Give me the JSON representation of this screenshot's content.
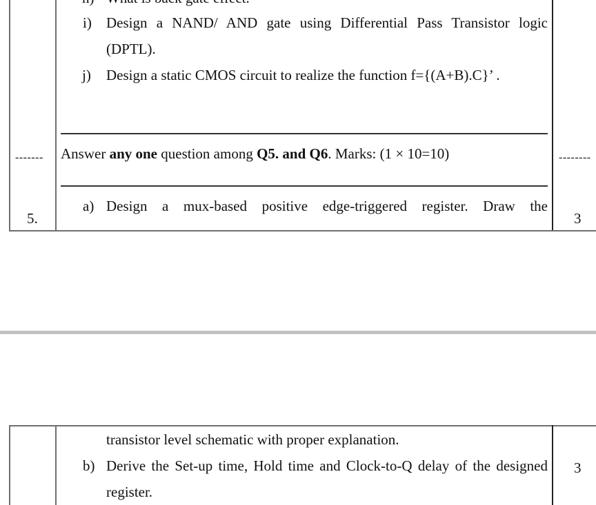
{
  "page1": {
    "items": [
      {
        "label": "h)",
        "text": "What is back gate effect."
      },
      {
        "label": "i)",
        "text_line1": "Design a NAND/ AND gate using Differential Pass Transistor logic",
        "text_line2": "(DPTL)."
      },
      {
        "label": "j)",
        "text": "Design a static CMOS circuit to realize the function f={(A+B).C}’ ."
      }
    ],
    "section_instruction": {
      "left_dashes": "-------",
      "part1": "Answer ",
      "bold1": "any one",
      "part2": " question among ",
      "bold2": "Q5. and Q6",
      "part3": ". Marks: (1 × 10=10)",
      "right_dashes": "--------"
    },
    "question": {
      "number": "5.",
      "item_a_label": "a)",
      "item_a_line1": "Design a mux-based positive edge-triggered register. Draw the",
      "marks": "3"
    }
  },
  "page2": {
    "item_a_line2": "transistor level schematic with proper explanation.",
    "item_b_label": "b)",
    "item_b_line1": "Derive the Set-up time, Hold time and Clock-to-Q delay of the designed",
    "item_b_line2": "register.",
    "marks": "3"
  }
}
